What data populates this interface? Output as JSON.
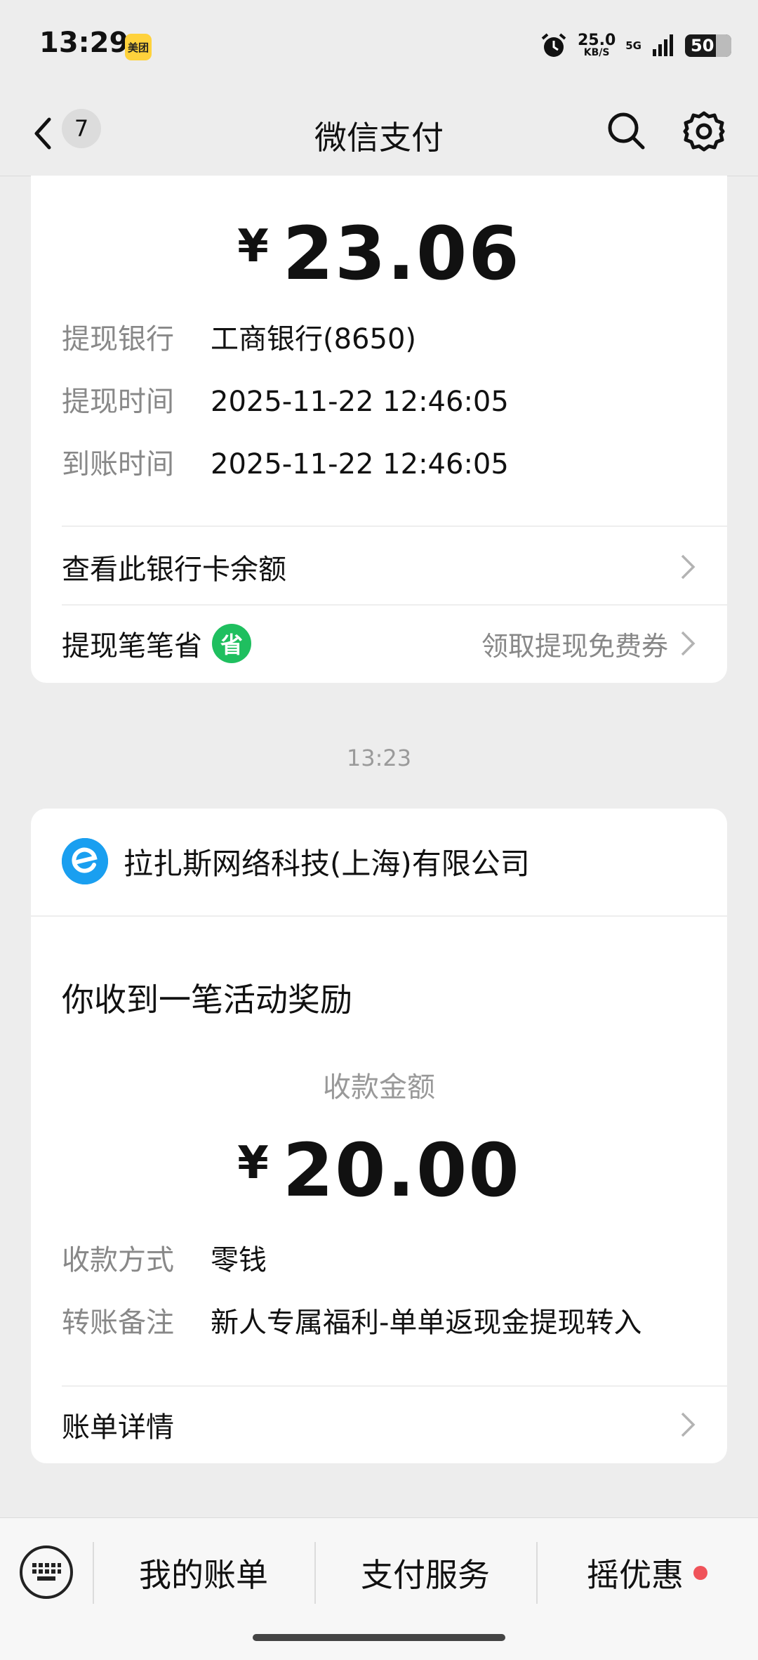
{
  "status_bar": {
    "time": "13:29",
    "app_badge": "美团",
    "net_speed": "25.0",
    "net_speed_unit": "KB/S",
    "network": "5G",
    "battery": "50",
    "icons": [
      "alarm-icon",
      "signal-icon",
      "battery-icon"
    ]
  },
  "nav": {
    "title": "微信支付",
    "unread_count": "7",
    "icons": [
      "back-icon",
      "search-icon",
      "gear-icon"
    ]
  },
  "withdraw_card": {
    "currency": "¥",
    "amount": "23.06",
    "details": [
      {
        "label": "提现银行",
        "value": "工商银行(8650)"
      },
      {
        "label": "提现时间",
        "value": "2025-11-22 12:46:05"
      },
      {
        "label": "到账时间",
        "value": "2025-11-22 12:46:05"
      }
    ],
    "balance_link": "查看此银行卡余额",
    "promo_label": "提现笔笔省",
    "promo_icon_text": "省",
    "promo_action": "领取提现免费券"
  },
  "timestamp": "13:23",
  "reward_card": {
    "merchant": "拉扎斯网络科技(上海)有限公司",
    "headline": "你收到一笔活动奖励",
    "amount_label": "收款金额",
    "currency": "¥",
    "amount": "20.00",
    "details": [
      {
        "label": "收款方式",
        "value": "零钱"
      },
      {
        "label": "转账备注",
        "value": "新人专属福利-单单返现金提现转入"
      }
    ],
    "detail_link": "账单详情"
  },
  "bottom_bar": {
    "tabs": [
      {
        "label": "我的账单"
      },
      {
        "label": "支付服务"
      },
      {
        "label": "摇优惠"
      }
    ]
  },
  "colors": {
    "background": "#ededed",
    "card": "#ffffff",
    "accent_green": "#1fbf5f",
    "merchant_blue": "#1a9ff0",
    "notify_red": "#f0535a"
  }
}
